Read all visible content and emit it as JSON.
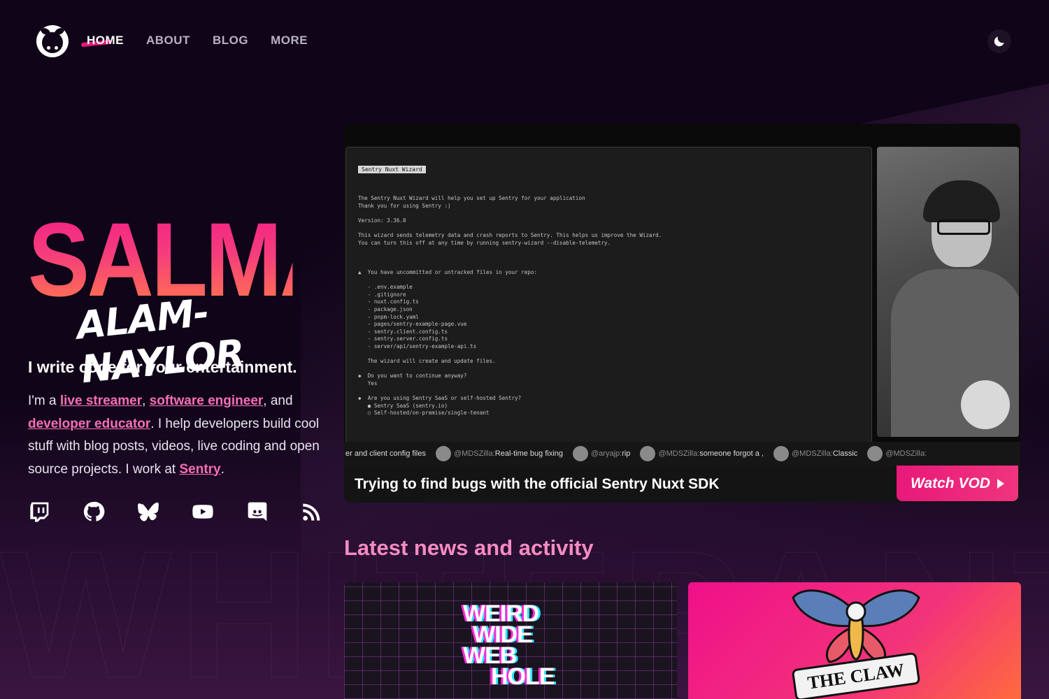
{
  "nav": {
    "items": [
      {
        "label": "HOME",
        "active": true
      },
      {
        "label": "ABOUT",
        "active": false
      },
      {
        "label": "BLOG",
        "active": false
      },
      {
        "label": "MORE",
        "active": false
      }
    ],
    "theme_toggle_icon": "moon-icon"
  },
  "hero": {
    "first_name": "SALMA",
    "last_name": "ALAM-NAYLOR",
    "tagline": "I write code for your entertainment.",
    "bio": {
      "prefix": "I'm a ",
      "link_live_streamer": "live streamer",
      "sep1": ", ",
      "link_software_engineer": "software engineer",
      "sep2": ", and ",
      "link_developer_educator": "developer educator",
      "middle": ". I help developers build cool stuff with blog posts, videos, live coding and open source projects. I work at ",
      "link_sentry": "Sentry",
      "suffix": "."
    },
    "socials": [
      "twitch-icon",
      "github-icon",
      "bluesky-icon",
      "youtube-icon",
      "discord-icon",
      "rss-icon"
    ]
  },
  "video": {
    "terminal_title": "Sentry Nuxt Wizard",
    "terminal_lines": [
      "The Sentry Nuxt Wizard will help you set up Sentry for your application",
      "Thank you for using Sentry :)",
      "",
      "Version: 3.36.0",
      "",
      "This wizard sends telemetry data and crash reports to Sentry. This helps us improve the Wizard.",
      "You can turn this off at any time by running sentry-wizard --disable-telemetry.",
      "",
      "",
      "",
      "▲  You have uncommitted or untracked files in your repo:",
      "",
      "   - .env.example",
      "   - .gitignore",
      "   - nuxt.config.ts",
      "   - package.json",
      "   - pnpm-lock.yaml",
      "   - pages/sentry-example-page.vue",
      "   - sentry.client.config.ts",
      "   - sentry.server.config.ts",
      "   - server/api/sentry-example-api.ts",
      "",
      "   The wizard will create and update files.",
      "",
      "◆  Do you want to continue anyway?",
      "   Yes",
      "",
      "◆  Are you using Sentry SaaS or self-hosted Sentry?",
      "   ● Sentry SaaS (sentry.io)",
      "   ○ Self-hosted/on-premise/single-tenant"
    ],
    "chat": [
      {
        "name": "",
        "msg": "er and client config files"
      },
      {
        "name": "@MDSZilla:",
        "msg": "Real-time bug fixing"
      },
      {
        "name": "@aryajp:",
        "msg": "rip"
      },
      {
        "name": "@MDSZilla:",
        "msg": "someone forgot a ,"
      },
      {
        "name": "@MDSZilla:",
        "msg": "Classic"
      },
      {
        "name": "@MDSZilla:",
        "msg": ""
      }
    ],
    "title": "Trying to find bugs with the official Sentry Nuxt SDK",
    "vod_label": "Watch VOD"
  },
  "news": {
    "title": "Latest news and activity",
    "cards": [
      {
        "art_lines": [
          "WEIRD",
          "WIDE",
          "WEB",
          "HOLE"
        ]
      },
      {
        "art_text": "THE CLAW"
      }
    ]
  },
  "colors": {
    "background": "#0f0418",
    "accent_pink": "#e8197a",
    "section_title": "#f58bc3",
    "link": "#f56fb5"
  }
}
